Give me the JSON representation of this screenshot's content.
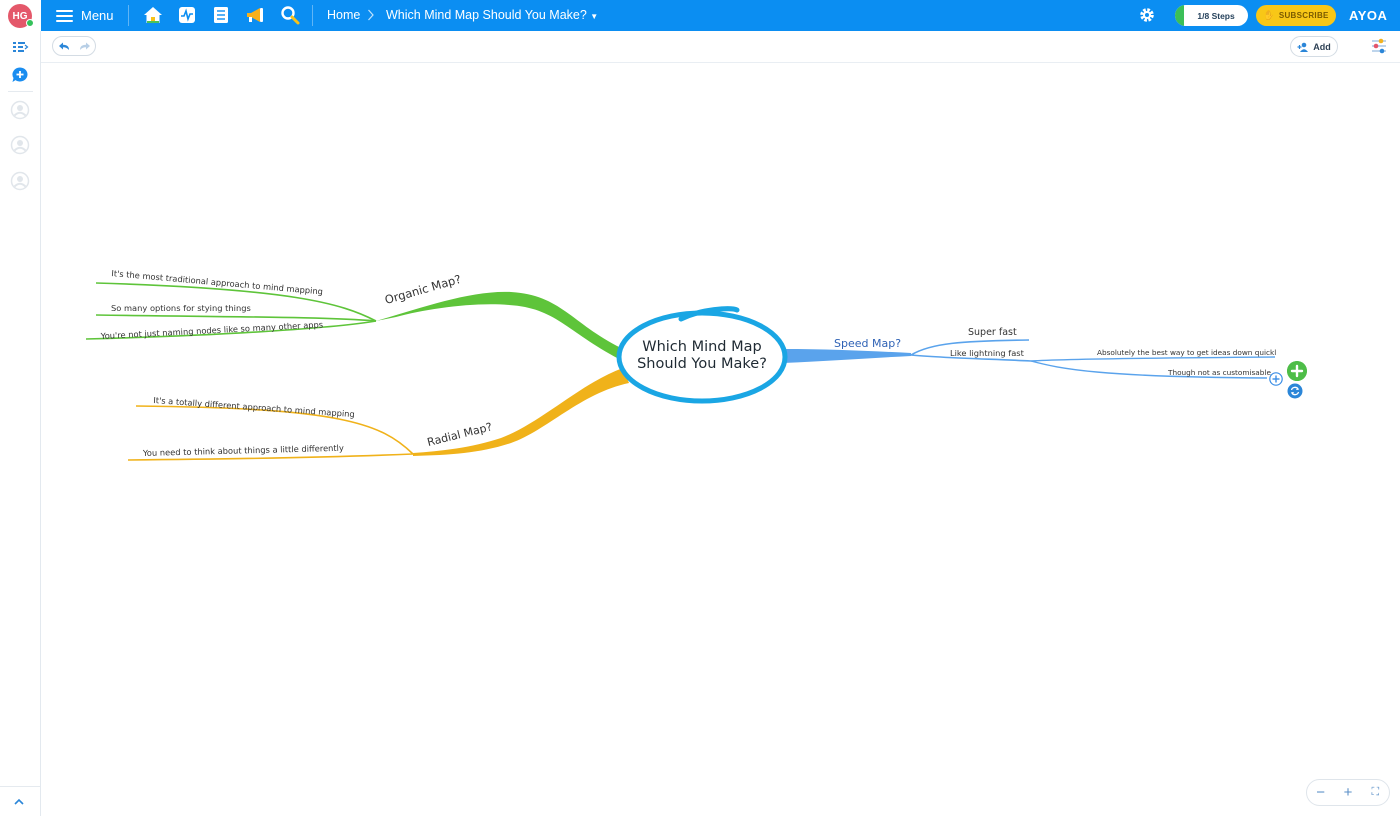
{
  "user": {
    "initials": "HG"
  },
  "topbar": {
    "menu_label": "Menu",
    "nav_icons": [
      "home-icon",
      "activity-icon",
      "notebook-icon",
      "megaphone-icon",
      "search-icon"
    ],
    "breadcrumb": {
      "home": "Home",
      "current": "Which Mind Map Should You Make?"
    },
    "steps_label": "1/8 Steps",
    "steps_progress": 0.125,
    "subscribe_label": "SUBSCRIBE",
    "brand": "AYOA"
  },
  "toolbar": {
    "add_label": "Add"
  },
  "mindmap": {
    "central": {
      "line1": "Which Mind Map",
      "line2": "Should You Make?",
      "color": "#1aa6e4"
    },
    "branches": [
      {
        "label": "Organic Map?",
        "color": "#5ec43a",
        "children": [
          "It's the most traditional approach to mind mapping",
          "So many options for stying things",
          "You're not just naming nodes like so many other apps"
        ]
      },
      {
        "label": "Radial Map?",
        "color": "#f0b21a",
        "children": [
          "It's a totally different approach to mind mapping",
          "You need to think about things a little differently"
        ]
      },
      {
        "label": "Speed Map?",
        "color": "#5aa3ec",
        "children": [
          {
            "label": "Super fast",
            "children": []
          },
          {
            "label": "Like lightning fast",
            "children": [
              "Absolutely the best way to get ideas down quickl",
              "Though not as customisable"
            ]
          }
        ]
      }
    ]
  },
  "zoom": {
    "out": "−",
    "in": "+",
    "fit": "⛶"
  }
}
